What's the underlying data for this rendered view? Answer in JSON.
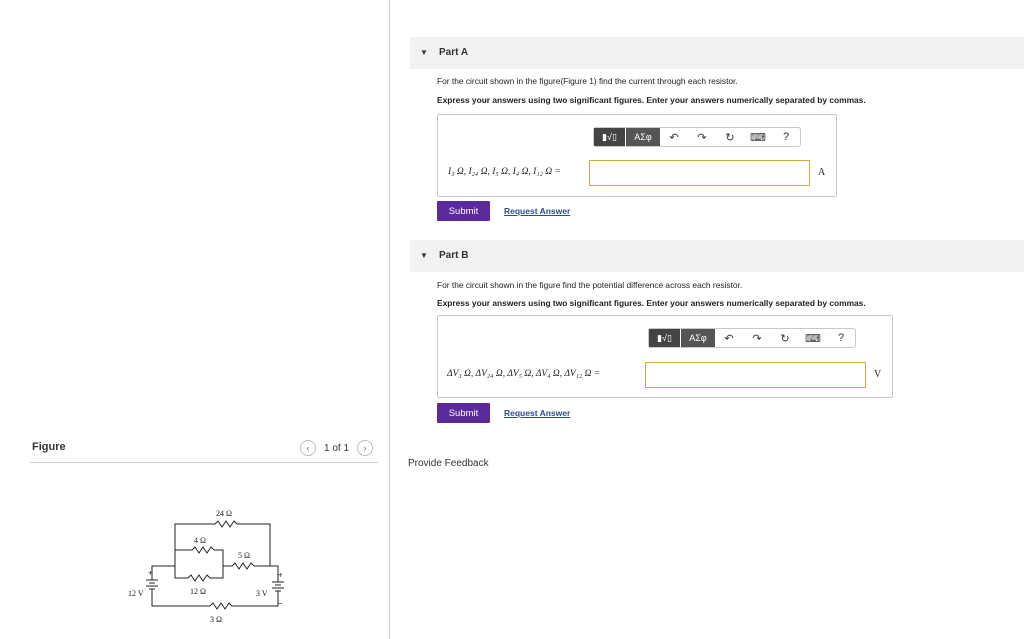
{
  "figure_panel": {
    "title": "Figure",
    "pager_text": "1 of 1",
    "prev_icon": "chevron-left-icon",
    "next_icon": "chevron-right-icon",
    "circuit": {
      "r24": "24 Ω",
      "r4": "4 Ω",
      "r5": "5 Ω",
      "r12": "12 Ω",
      "r3": "3 Ω",
      "v12": "12 V",
      "v3": "3 V",
      "plus": "+",
      "minus": "−"
    }
  },
  "part_a": {
    "title": "Part A",
    "description": "For the circuit shown in the figure(Figure 1) find the current through each resistor.",
    "instruction": "Express your answers using two significant figures. Enter your answers numerically separated by commas.",
    "toolbar": {
      "template": "▮√▯",
      "symbols": "ΑΣφ",
      "help": "?"
    },
    "equation_label": "I₃ Ω, I₂₄ Ω, I₅ Ω, I₄ Ω, I₁₂ Ω =",
    "answer_value": "",
    "unit": "A",
    "submit_label": "Submit",
    "request_label": "Request Answer"
  },
  "part_b": {
    "title": "Part B",
    "description": "For the circuit shown in the figure find the potential difference across each resistor.",
    "instruction": "Express your answers using two significant figures. Enter your answers numerically separated by commas.",
    "toolbar": {
      "template": "▮√▯",
      "symbols": "ΑΣφ",
      "help": "?"
    },
    "equation_label": "ΔV₃ Ω, ΔV₂₄ Ω, ΔV₅ Ω, ΔV₄ Ω, ΔV₁₂ Ω =",
    "answer_value": "",
    "unit": "V",
    "submit_label": "Submit",
    "request_label": "Request Answer"
  },
  "feedback_label": "Provide Feedback",
  "colors": {
    "submit": "#5b2a9d",
    "link": "#2a4d8f",
    "input_border": "#d4a840"
  }
}
